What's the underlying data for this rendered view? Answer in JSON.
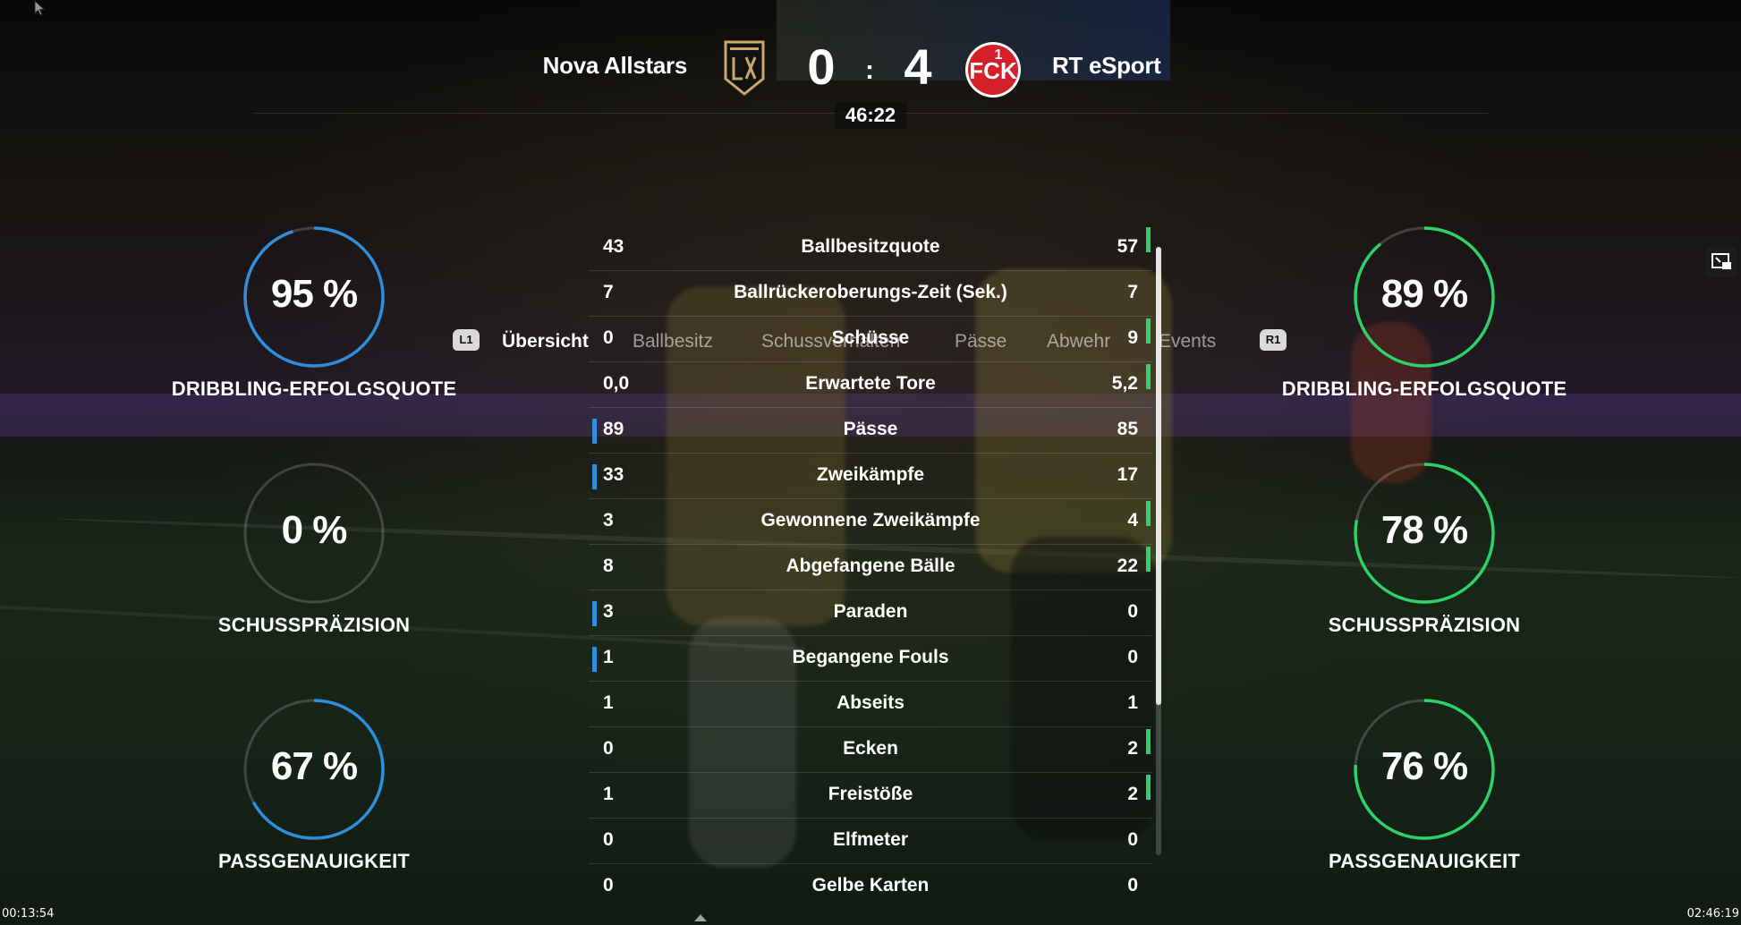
{
  "match": {
    "home_team": "Nova Allstars",
    "away_team": "RT eSport",
    "home_score": "0",
    "separator": ":",
    "away_score": "4",
    "clock": "46:22",
    "home_crest_icon": "lafc-crest-icon",
    "away_crest_icon": "fck-crest-icon",
    "home_color": "#2f8fdc",
    "away_color": "#2fd16a"
  },
  "tabs": {
    "left_bumper": "L1",
    "right_bumper": "R1",
    "items": [
      {
        "label": "Übersicht",
        "active": true
      },
      {
        "label": "Ballbesitz",
        "active": false
      },
      {
        "label": "Schussverhalten",
        "active": false
      },
      {
        "label": "Pässe",
        "active": false
      },
      {
        "label": "Abwehr",
        "active": false
      },
      {
        "label": "Events",
        "active": false
      }
    ]
  },
  "home_rings": [
    {
      "value": "95 %",
      "fraction": 0.95,
      "label": "DRIBBLING-ERFOLGSQUOTE"
    },
    {
      "value": "0 %",
      "fraction": 0.0,
      "label": "SCHUSSPRÄZISION"
    },
    {
      "value": "67 %",
      "fraction": 0.67,
      "label": "PASSGENAUIGKEIT"
    }
  ],
  "away_rings": [
    {
      "value": "89 %",
      "fraction": 0.89,
      "label": "DRIBBLING-ERFOLGSQUOTE"
    },
    {
      "value": "78 %",
      "fraction": 0.78,
      "label": "SCHUSSPRÄZISION"
    },
    {
      "value": "76 %",
      "fraction": 0.76,
      "label": "PASSGENAUIGKEIT"
    }
  ],
  "stats": [
    {
      "name": "Ballbesitzquote",
      "home": "43",
      "away": "57",
      "leader": "away"
    },
    {
      "name": "Ballrückeroberungs-Zeit (Sek.)",
      "home": "7",
      "away": "7",
      "leader": "none"
    },
    {
      "name": "Schüsse",
      "home": "0",
      "away": "9",
      "leader": "away"
    },
    {
      "name": "Erwartete Tore",
      "home": "0,0",
      "away": "5,2",
      "leader": "away"
    },
    {
      "name": "Pässe",
      "home": "89",
      "away": "85",
      "leader": "home"
    },
    {
      "name": "Zweikämpfe",
      "home": "33",
      "away": "17",
      "leader": "home"
    },
    {
      "name": "Gewonnene Zweikämpfe",
      "home": "3",
      "away": "4",
      "leader": "away"
    },
    {
      "name": "Abgefangene Bälle",
      "home": "8",
      "away": "22",
      "leader": "away"
    },
    {
      "name": "Paraden",
      "home": "3",
      "away": "0",
      "leader": "home"
    },
    {
      "name": "Begangene Fouls",
      "home": "1",
      "away": "0",
      "leader": "home"
    },
    {
      "name": "Abseits",
      "home": "1",
      "away": "1",
      "leader": "none"
    },
    {
      "name": "Ecken",
      "home": "0",
      "away": "2",
      "leader": "away"
    },
    {
      "name": "Freistöße",
      "home": "1",
      "away": "2",
      "leader": "away"
    },
    {
      "name": "Elfmeter",
      "home": "0",
      "away": "0",
      "leader": "none"
    },
    {
      "name": "Gelbe Karten",
      "home": "0",
      "away": "0",
      "leader": "none"
    }
  ],
  "video": {
    "elapsed": "00:13:54",
    "duration": "02:46:19"
  }
}
